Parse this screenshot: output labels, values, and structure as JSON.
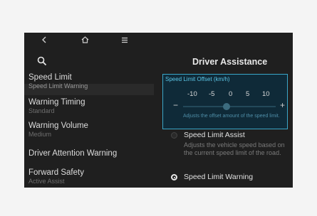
{
  "nav": {
    "back_icon": "chevron-left-icon",
    "home_icon": "home-icon",
    "menu_icon": "menu-icon"
  },
  "left_menu": [
    {
      "title": "Speed Limit",
      "subtitle": "Speed Limit Warning"
    },
    {
      "title": "Warning Timing",
      "subtitle": "Standard"
    },
    {
      "title": "Warning Volume",
      "subtitle": "Medium"
    },
    {
      "title": "Driver Attention Warning",
      "subtitle": ""
    },
    {
      "title": "Forward Safety",
      "subtitle": "Active Assist"
    }
  ],
  "page_title": "Driver Assistance",
  "offset_popup": {
    "title": "Speed Limit Offset (km/h)",
    "values": [
      "-10",
      "-5",
      "0",
      "5",
      "10"
    ],
    "minus": "−",
    "plus": "+",
    "description": "Adjusts the offset amount of the speed limit."
  },
  "options": [
    {
      "label": "Speed Limit Assist",
      "description": "Adjusts the vehicle speed based on the current speed limit of the road.",
      "selected": false
    },
    {
      "label": "Speed Limit Warning",
      "description": "",
      "selected": true
    }
  ],
  "colors": {
    "accent": "#3aa6c8",
    "screen_bg": "#1f1f1f"
  }
}
